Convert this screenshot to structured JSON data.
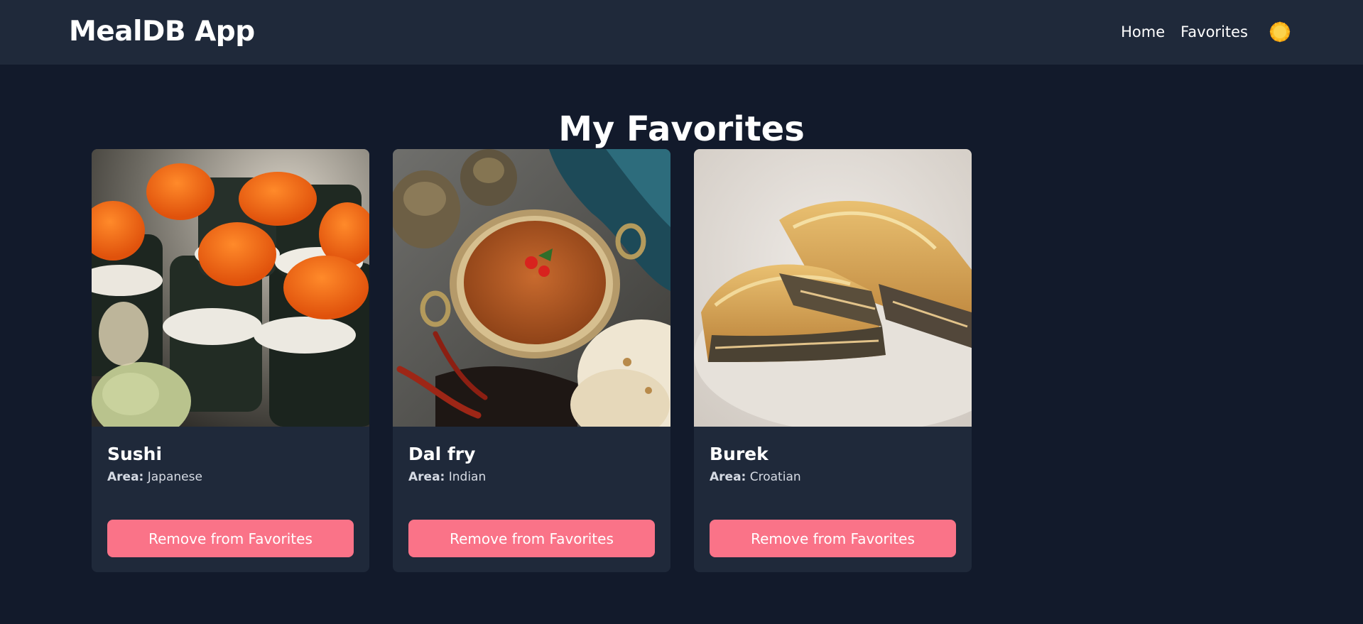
{
  "header": {
    "brand": "MealDB App",
    "nav": [
      {
        "label": "Home"
      },
      {
        "label": "Favorites"
      }
    ],
    "theme_icon": "sun-icon"
  },
  "page": {
    "title": "My Favorites"
  },
  "favorites": [
    {
      "name": "Sushi",
      "area_label": "Area:",
      "area": "Japanese",
      "button": "Remove from Favorites"
    },
    {
      "name": "Dal fry",
      "area_label": "Area:",
      "area": "Indian",
      "button": "Remove from Favorites"
    },
    {
      "name": "Burek",
      "area_label": "Area:",
      "area": "Croatian",
      "button": "Remove from Favorites"
    }
  ],
  "colors": {
    "page_bg": "#121a2b",
    "header_bg": "#1f293a",
    "card_bg": "#1f293a",
    "button_bg": "#fa7388",
    "sun": "#fbbf24"
  }
}
